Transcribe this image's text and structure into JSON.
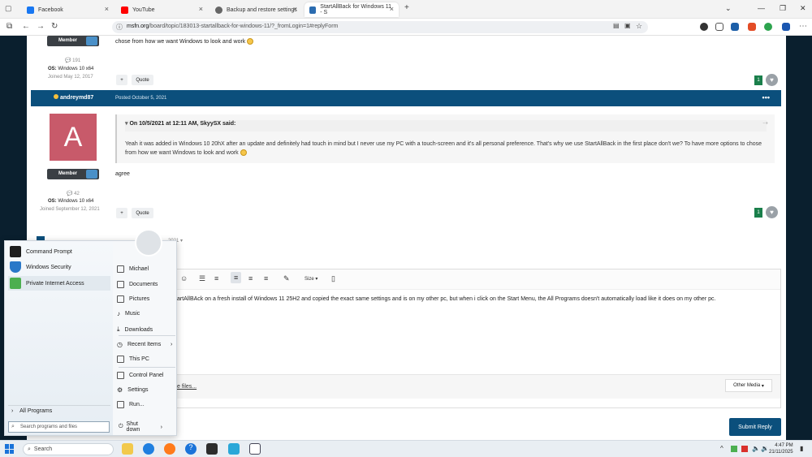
{
  "browser": {
    "tabs": [
      {
        "title": "Facebook",
        "color": "#1877f2"
      },
      {
        "title": "YouTube",
        "color": "#ff0000"
      },
      {
        "title": "Backup and restore settings",
        "color": "#555555"
      },
      {
        "title": "StartAllBack for Windows 11 - S",
        "color": "#2b6cb0"
      }
    ],
    "new_tab": "+",
    "url_domain": "msfn.org",
    "url_path": "/board/topic/183013-startallback-for-windows-11/?_fromLogin=1#replyForm"
  },
  "prev_post": {
    "text_tail": "chose from how we want Windows to look and work",
    "member_label": "Member",
    "post_count": "191",
    "os_label": "OS:",
    "os_value": "Windows 10 x64",
    "joined": "Joined May 12, 2017",
    "plus": "+",
    "quote_btn": "Quote",
    "likes": "1"
  },
  "post": {
    "author": "andreymd87",
    "posted": "Posted October 5, 2021",
    "menu": "•••",
    "avatar_letter": "A",
    "member_label": "Member",
    "post_count": "42",
    "os_label": "OS:",
    "os_value": "Windows 10 x64",
    "joined": "Joined September 12, 2021",
    "quote_header": "On 10/5/2021 at 12:11 AM, SkyySX said:",
    "quote_body": "Yeah it was added in Windows 10 20hX after an update and definitely had touch in mind but I never use my PC with a touch-screen and it's all personal preference. That's why we use StartAllBack in the first place don't we? To have more options to chose from how we want Windows to look and work",
    "body": "agree",
    "plus": "+",
    "quote_btn": "Quote",
    "likes": "1"
  },
  "reply_partial_date": "2021",
  "editor": {
    "size_label": "Size",
    "text": "artAllBAck on a fresh install of Windows 11 25H2 and copied the exact same settings and is on my other pc, but when i click on the Start Menu, the All Programs doesn't automatically load like it does on my other pc.",
    "attach_link": "e files...",
    "other_media": "Other Media"
  },
  "submit_label": "Submit Reply",
  "start_menu": {
    "pinned": [
      {
        "label": "Command Prompt",
        "color": "#1e1e1e"
      },
      {
        "label": "Windows Security",
        "color": "#2a78c8"
      },
      {
        "label": "Private Internet Access",
        "color": "#4caf50"
      }
    ],
    "right_items": [
      {
        "label": "Michael"
      },
      {
        "label": "Documents"
      },
      {
        "label": "Pictures"
      },
      {
        "label": "Music"
      },
      {
        "label": "Downloads"
      },
      {
        "label": "Recent Items"
      },
      {
        "label": "This PC"
      },
      {
        "label": "Control Panel"
      },
      {
        "label": "Settings"
      },
      {
        "label": "Run..."
      }
    ],
    "all_programs": "All Programs",
    "search_placeholder": "Search programs and files",
    "shutdown": "Shut down"
  },
  "taskbar": {
    "search_label": "Search",
    "time": "4:47 PM",
    "date": "21/11/2025"
  }
}
